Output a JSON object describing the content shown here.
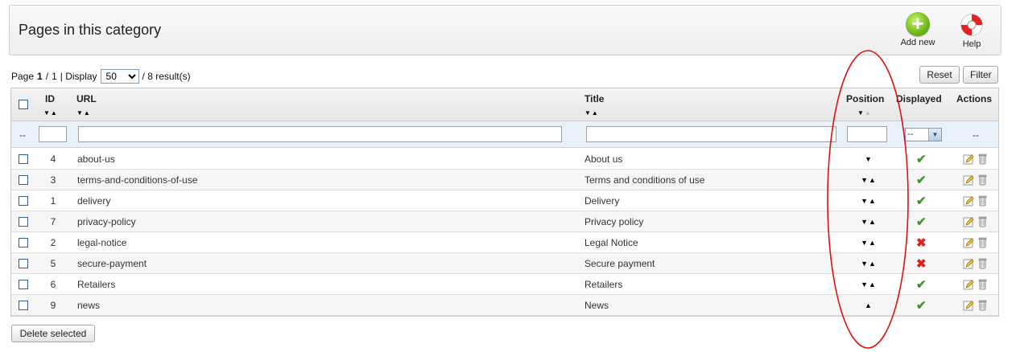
{
  "toolbar": {
    "title": "Pages in this category",
    "add_label": "Add new",
    "help_label": "Help",
    "add_icon": "plus-circle-icon",
    "help_icon": "lifebuoy-icon"
  },
  "pager": {
    "page_word": "Page",
    "current": "1",
    "sep": "/",
    "total": "1",
    "display_word": "| Display",
    "per_page": "50",
    "results": "/ 8 result(s)"
  },
  "buttons": {
    "reset": "Reset",
    "filter": "Filter",
    "delete_selected": "Delete selected"
  },
  "columns": {
    "id": "ID",
    "url": "URL",
    "title": "Title",
    "position": "Position",
    "displayed": "Displayed",
    "actions": "Actions"
  },
  "filter_row": {
    "dash": "--",
    "displayed_value": "--",
    "actions_dash": "--"
  },
  "rows": [
    {
      "id": "4",
      "url": "about-us",
      "title": "About us",
      "position": "down",
      "displayed": true
    },
    {
      "id": "3",
      "url": "terms-and-conditions-of-use",
      "title": "Terms and conditions of use",
      "position": "both",
      "displayed": true
    },
    {
      "id": "1",
      "url": "delivery",
      "title": "Delivery",
      "position": "both",
      "displayed": true
    },
    {
      "id": "7",
      "url": "privacy-policy",
      "title": "Privacy policy",
      "position": "both",
      "displayed": true
    },
    {
      "id": "2",
      "url": "legal-notice",
      "title": "Legal Notice",
      "position": "both",
      "displayed": false
    },
    {
      "id": "5",
      "url": "secure-payment",
      "title": "Secure payment",
      "position": "both",
      "displayed": false
    },
    {
      "id": "6",
      "url": "Retailers",
      "title": "Retailers",
      "position": "both",
      "displayed": true
    },
    {
      "id": "9",
      "url": "news",
      "title": "News",
      "position": "up",
      "displayed": true
    }
  ],
  "colors": {
    "annotation": "#e01010",
    "ok": "#3a9b2a",
    "no": "#e02020",
    "filter_bg": "#e8f0fa"
  }
}
